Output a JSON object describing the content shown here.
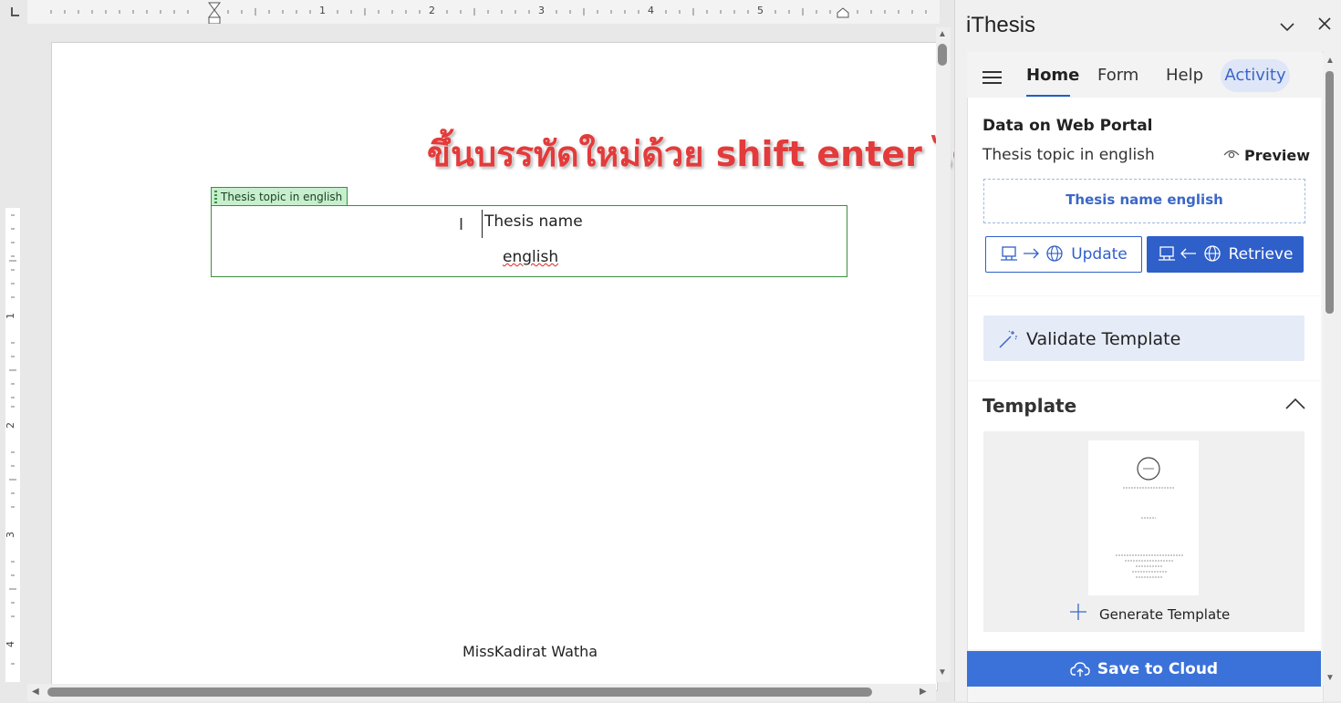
{
  "document": {
    "annotation": "ขึ้นบรรทัดใหม่ด้วย shift enter ได้",
    "content_control_tag": "Thesis topic in english",
    "line1": "Thesis name",
    "line2": "english",
    "footer_name": "MissKadirat Watha"
  },
  "ruler": {
    "horizontal_numbers": [
      "1",
      "2",
      "3",
      "4",
      "5"
    ],
    "vertical_numbers": [
      "1",
      "2",
      "3",
      "4"
    ]
  },
  "pane": {
    "title": "iThesis",
    "tabs": [
      {
        "label": "Home",
        "active": true
      },
      {
        "label": "Form"
      },
      {
        "label": "Help"
      },
      {
        "label": "Activity"
      }
    ],
    "portal": {
      "heading": "Data on Web Portal",
      "field_label": "Thesis topic in english",
      "preview_label": "Preview",
      "field_value": "Thesis name english",
      "update_label": "Update",
      "retrieve_label": "Retrieve"
    },
    "validate_label": "Validate Template",
    "template": {
      "heading": "Template",
      "generate_label": "Generate Template"
    },
    "save_label": "Save to Cloud"
  },
  "colors": {
    "accent": "#3b72d9",
    "content_control_green": "#3c8f3c",
    "annotation_red": "#e33b3b"
  }
}
